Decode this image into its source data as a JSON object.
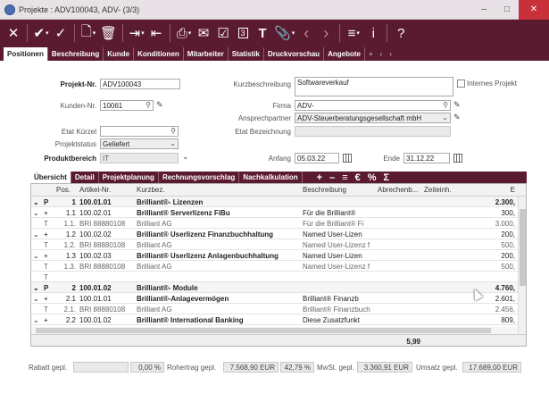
{
  "window": {
    "title": "Projekte : ADV100043, ADV- (3/3)",
    "minimize": "–",
    "maximize": "□",
    "close": "✕"
  },
  "toolbar": {
    "close_glyph": "✕",
    "check_all_glyph": "✔",
    "check_glyph": "✓",
    "new_doc_glyph": "🗋",
    "delete_glyph": "🗑",
    "import_glyph": "⇥",
    "export_glyph": "⇤",
    "print_glyph": "⎙",
    "mail_glyph": "✉",
    "task_glyph": "☑",
    "calendar_glyph": "3",
    "teams_glyph": "T",
    "attach_glyph": "📎",
    "prev_glyph": "‹",
    "next_glyph": "›",
    "menu_glyph": "≡",
    "info_glyph": "i",
    "help_glyph": "?"
  },
  "tabs": [
    "Positionen",
    "Beschreibung",
    "Kunde",
    "Konditionen",
    "Mitarbeiter",
    "Statistik",
    "Druckvorschau",
    "Angebote"
  ],
  "tabs_extra": {
    "plus": "+",
    "prev": "‹",
    "next": "›"
  },
  "form": {
    "projekt_nr_label": "Projekt-Nr.",
    "projekt_nr": "ADV100043",
    "kunden_nr_label": "Kunden-Nr.",
    "kunden_nr": "10061",
    "etat_kurzel_label": "Etat Kürzel",
    "etat_kurzel": "",
    "projektstatus_label": "Projektstatus",
    "projektstatus": "Geliefert",
    "produktbereich_label": "Produktbereich",
    "produktbereich": "IT",
    "kurzbeschreibung_label": "Kurzbeschreibung",
    "kurzbeschreibung": "Softwareverkauf",
    "internes_projekt_label": "Internes Projekt",
    "firma_label": "Firma",
    "firma": "ADV-",
    "ansprechpartner_label": "Ansprechpartner",
    "ansprechpartner": "ADV-Steuerberatungsgesellschaft mbH",
    "etat_bezeichnung_label": "Etat Bezeichnung",
    "etat_bezeichnung": "",
    "anfang_label": "Anfang",
    "anfang": "05.03.22",
    "ende_label": "Ende",
    "ende": "31.12.22"
  },
  "subtabs": [
    "Übersicht",
    "Detail",
    "Projektplanung",
    "Rechnungsvorschlag",
    "Nachkalkulation"
  ],
  "subtab_tools": [
    "+",
    "–",
    "≡",
    "€",
    "%",
    "Σ"
  ],
  "grid": {
    "headers": [
      "Pos.",
      "Artikel-Nr.",
      "Kurzbez.",
      "Beschreibung",
      "Abrechenb...",
      "Zeiteinh.",
      "E"
    ],
    "rows": [
      {
        "exp": "⌄",
        "typ": "P",
        "pos": "1",
        "art": "100.01.01",
        "kurz": "Brilliant®- Lizenzen",
        "besch": "",
        "abr": "",
        "zeit": "",
        "e": "2.300,",
        "kind": "pos"
      },
      {
        "exp": "⌄",
        "typ": "+",
        "pos": "1.1",
        "art": "100.02.01",
        "kurz": "Brilliant® Serverlizenz FiBu",
        "besch": "Für die Brilliant®",
        "abr": "",
        "zeit": "",
        "e": "300,",
        "kind": "mid"
      },
      {
        "exp": "",
        "typ": "T",
        "pos": "1.1.",
        "art": "BRI 88880108",
        "kurz": "Brilliant AG",
        "besch": "Für die Brilliant® Fi",
        "abr": "",
        "zeit": "",
        "e": "3.000,",
        "kind": "sub"
      },
      {
        "exp": "⌄",
        "typ": "+",
        "pos": "1.2",
        "art": "100.02.02",
        "kurz": "Brilliant® Userlizenz Finanzbuchhaltung",
        "besch": "Named User-Lizen",
        "abr": "",
        "zeit": "",
        "e": "200,",
        "kind": "mid"
      },
      {
        "exp": "",
        "typ": "T",
        "pos": "1.2.",
        "art": "BRI 88880108",
        "kurz": "Brilliant AG",
        "besch": "Named User-Lizenz f",
        "abr": "",
        "zeit": "",
        "e": "500,",
        "kind": "sub"
      },
      {
        "exp": "⌄",
        "typ": "+",
        "pos": "1.3",
        "art": "100.02.03",
        "kurz": "Brilliant® Userlizenz Anlagenbuchhaltung",
        "besch": "Named User-Lizen",
        "abr": "",
        "zeit": "",
        "e": "200,",
        "kind": "mid"
      },
      {
        "exp": "",
        "typ": "T",
        "pos": "1.3.",
        "art": "BRI 88880108",
        "kurz": "Brilliant AG",
        "besch": "Named User-Lizenz f",
        "abr": "",
        "zeit": "",
        "e": "500,",
        "kind": "sub"
      },
      {
        "exp": "",
        "typ": "T",
        "pos": "",
        "art": "",
        "kurz": "",
        "besch": "",
        "abr": "",
        "zeit": "",
        "e": "",
        "kind": "sub"
      },
      {
        "exp": "⌄",
        "typ": "P",
        "pos": "2",
        "art": "100.01.02",
        "kurz": "Brilliant®- Module",
        "besch": "",
        "abr": "",
        "zeit": "",
        "e": "4.760,",
        "kind": "pos"
      },
      {
        "exp": "⌄",
        "typ": "+",
        "pos": "2.1",
        "art": "100.01.01",
        "kurz": "Brilliant®-Anlagevermögen",
        "besch": "Brilliant® Finanzb",
        "abr": "",
        "zeit": "",
        "e": "2.601,",
        "kind": "mid"
      },
      {
        "exp": "",
        "typ": "T",
        "pos": "2.1.",
        "art": "BRI 88880108",
        "kurz": "Brilliant AG",
        "besch": "Brilliant® Finanzbuch",
        "abr": "",
        "zeit": "",
        "e": "2.456,",
        "kind": "sub"
      },
      {
        "exp": "⌄",
        "typ": "+",
        "pos": "2.2",
        "art": "100.01.02",
        "kurz": "Brilliant® International Banking",
        "besch": "Diese Zusatzfunkt",
        "abr": "",
        "zeit": "",
        "e": "809,",
        "kind": "mid"
      }
    ],
    "footer_value": "5,99"
  },
  "summary": {
    "rabatt_label": "Rabatt gepl.",
    "rabatt": "",
    "rabatt_pct": "0,00 %",
    "rohertrag_label": "Rohertrag gepl.",
    "rohertrag": "7.568,90 EUR",
    "rohertrag_pct": "42,79 %",
    "mwst_label": "MwSt. gepl.",
    "mwst": "3.360,91 EUR",
    "umsatz_label": "Umsatz gepl.",
    "umsatz": "17.689,00 EUR"
  }
}
